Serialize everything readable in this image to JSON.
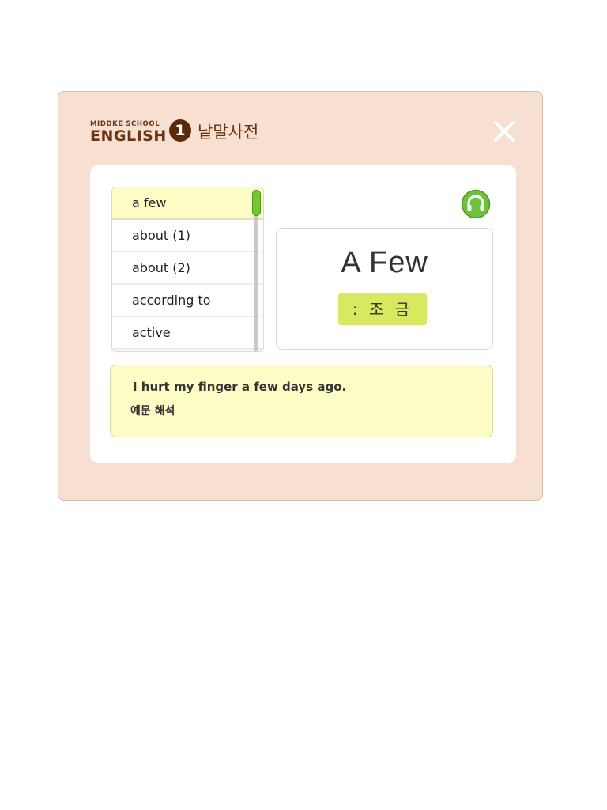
{
  "header": {
    "brand_small": "MIDDKE SCHOOL",
    "brand_big": "ENGLISH",
    "brand_number": "1",
    "title": "낱말사전",
    "close_icon": "close-x"
  },
  "word_list": {
    "selected_index": 0,
    "items": [
      {
        "label": "a few"
      },
      {
        "label": "about (1)"
      },
      {
        "label": "about (2)"
      },
      {
        "label": "according to"
      },
      {
        "label": "active"
      }
    ]
  },
  "definition": {
    "word": "A Few",
    "meaning": ": 조 금",
    "audio_icon": "headphones-icon"
  },
  "example": {
    "sentence": "I hurt my finger a few days ago.",
    "translation_label": "예문 해석"
  },
  "colors": {
    "panel_bg": "#f7e0d2",
    "accent_green": "#76c72e",
    "highlight_yellow": "#fdfcc4",
    "meaning_bg": "#d8e860",
    "brand_brown": "#6a3410"
  }
}
